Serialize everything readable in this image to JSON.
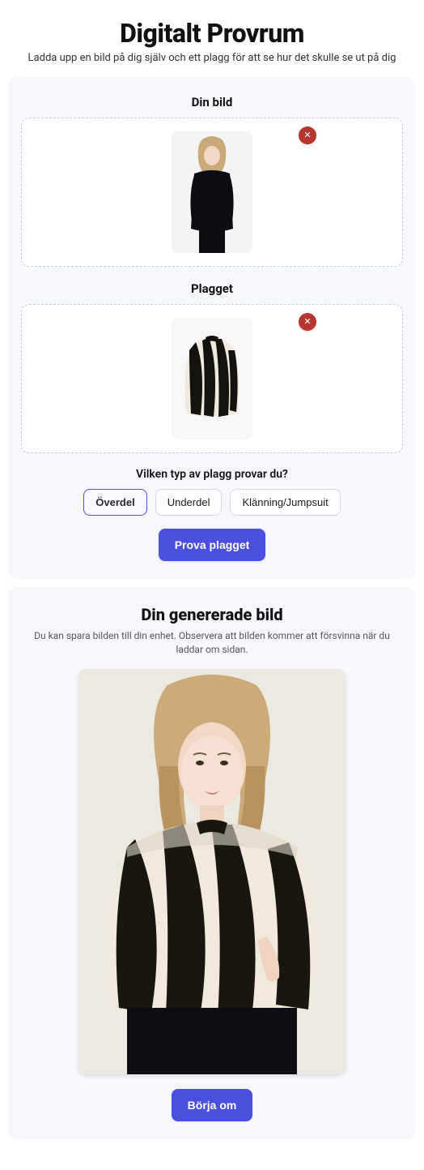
{
  "header": {
    "title": "Digitalt Provrum",
    "subtitle": "Ladda upp en bild på dig själv och ett plagg för att se hur det skulle se ut på dig"
  },
  "uploads": {
    "user_label": "Din bild",
    "garment_label": "Plagget",
    "remove_icon_label": "✕"
  },
  "garment_type": {
    "prompt": "Vilken typ av plagg provar du?",
    "options": [
      {
        "label": "Överdel",
        "selected": true
      },
      {
        "label": "Underdel",
        "selected": false
      },
      {
        "label": "Klänning/Jumpsuit",
        "selected": false
      }
    ]
  },
  "actions": {
    "try_button": "Prova plagget",
    "restart_button": "Börja om"
  },
  "result": {
    "title": "Din genererade bild",
    "note": "Du kan spara bilden till din enhet. Observera att bilden kommer att försvinna när du laddar om sidan."
  }
}
